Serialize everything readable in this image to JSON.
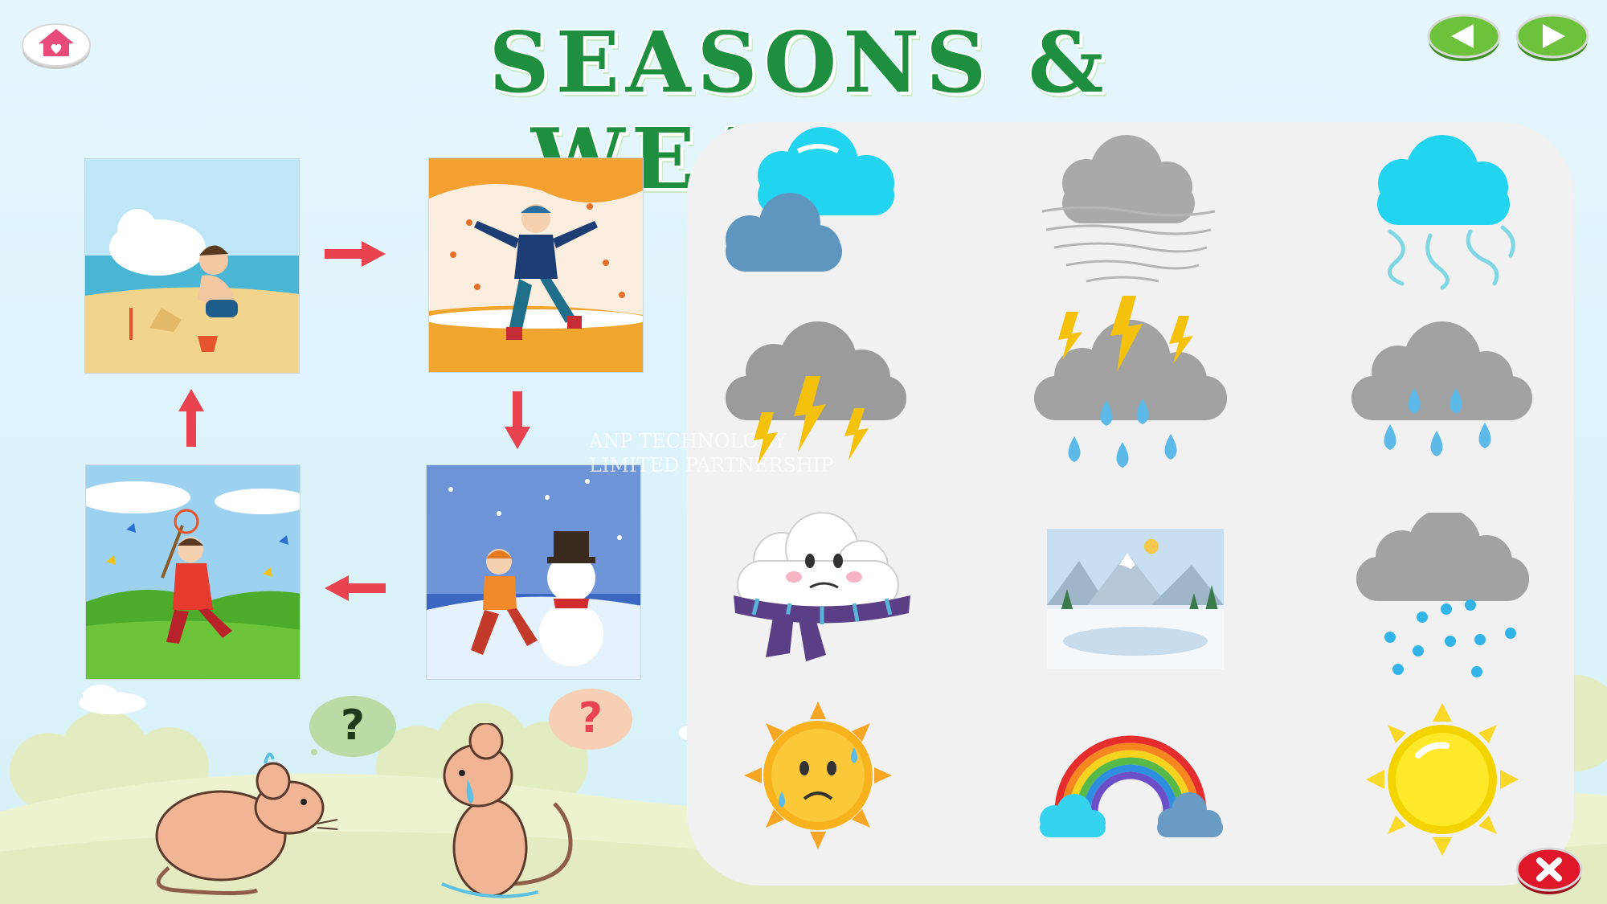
{
  "title": "SEASONS & WEATHER",
  "watermark": {
    "line1": "ANP TECHNOLOGY",
    "line2": "LIMITED PARTNERSHIP"
  },
  "question_marks": [
    "?",
    "?"
  ],
  "colors": {
    "title_green": "#1e8f3e",
    "nav_green": "#6cc23a",
    "close_red": "#e0162b",
    "home_pink": "#e84a7a",
    "arrow_red": "#e8434f"
  },
  "buttons": {
    "home": "home-icon",
    "prev": "arrow-left-icon",
    "next": "arrow-right-icon",
    "close": "close-icon"
  },
  "seasons": [
    "summer",
    "autumn",
    "winter",
    "spring"
  ],
  "weather_icons": [
    "cloudy",
    "foggy",
    "windy",
    "thunderstorm",
    "thunderstorm-with-rain",
    "rainy",
    "cold",
    "winter-landscape",
    "snowy",
    "hot",
    "rainbow",
    "sunny"
  ]
}
